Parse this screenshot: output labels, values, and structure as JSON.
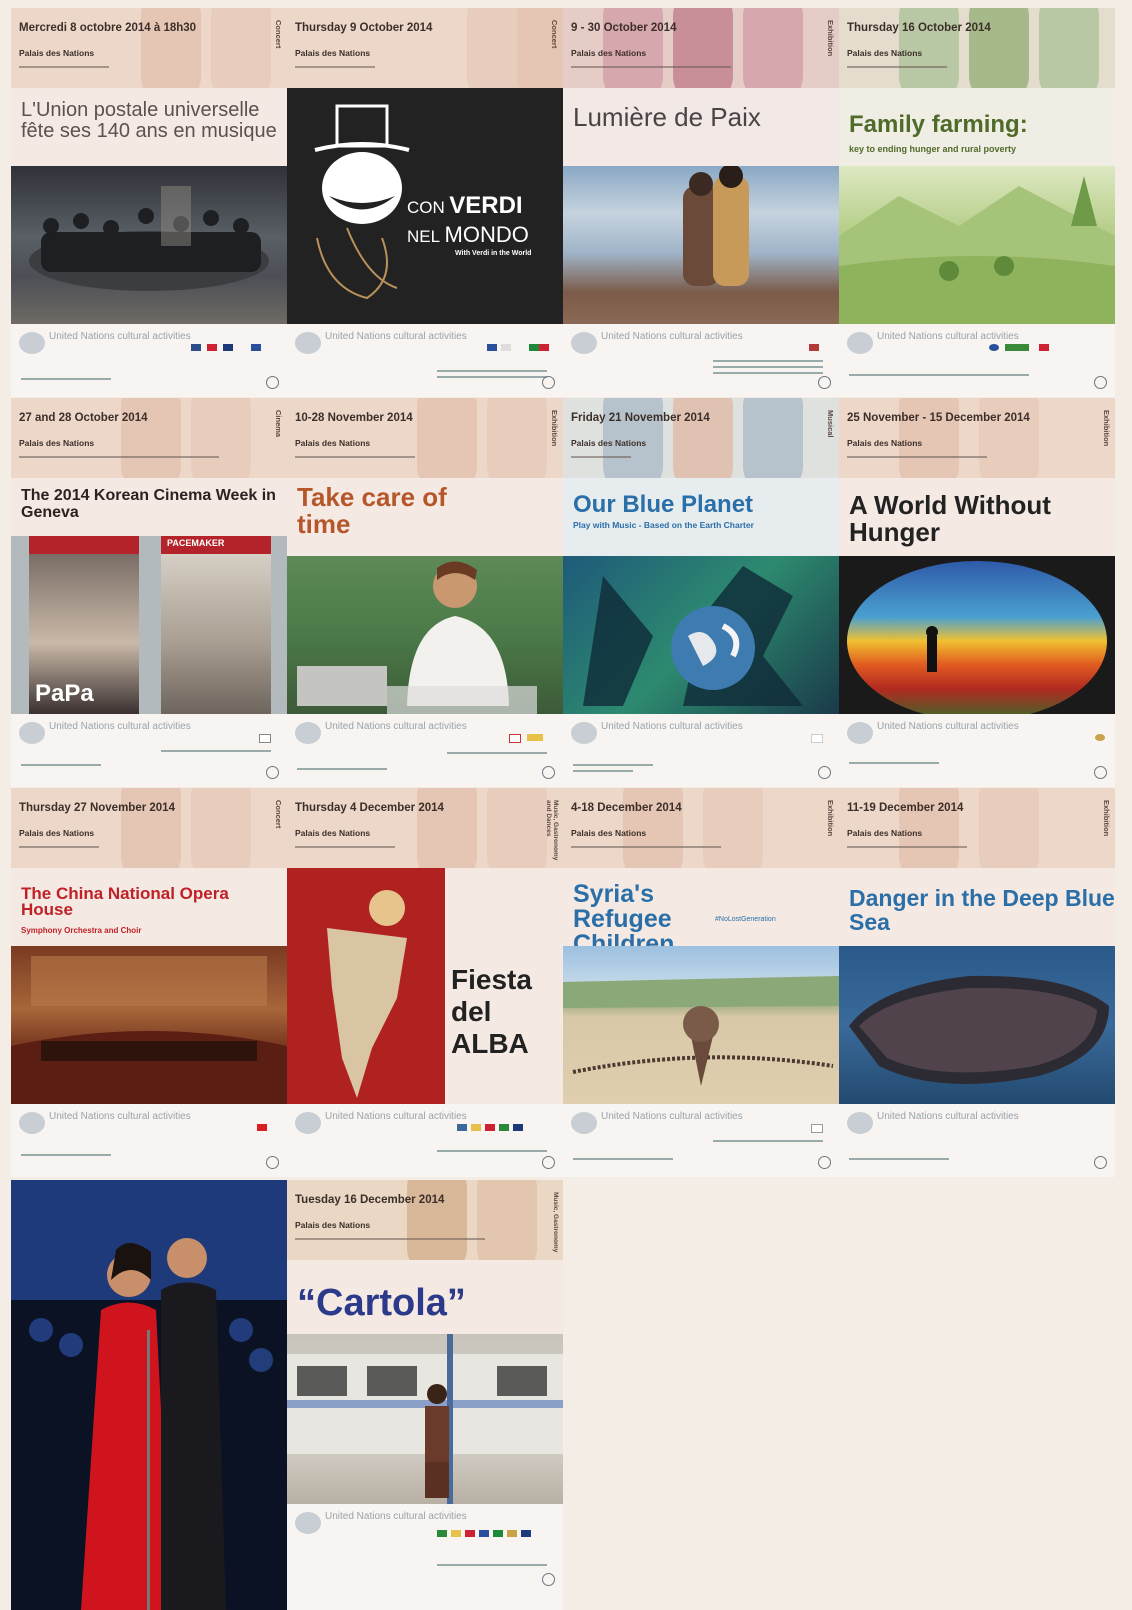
{
  "posters": [
    {
      "date": "Mercredi 8 octobre 2014 à 18h30",
      "venue": "Palais des Nations",
      "category": "Concert",
      "title": "L'Union postale universelle fête ses 140 ans en musique",
      "footer": "United Nations cultural activities"
    },
    {
      "date": "Thursday 9 October 2014",
      "venue": "Palais des Nations",
      "category": "Concert",
      "title_small": "CON",
      "title_big": "VERDI",
      "title_small2": "NEL",
      "title_big2": "MONDO",
      "subtitle": "With Verdi in the World",
      "footer": "United Nations cultural activities"
    },
    {
      "date": "9 - 30 October 2014",
      "venue": "Palais des Nations",
      "category": "Exhibition",
      "title": "Lumière de Paix",
      "footer": "United Nations cultural activities"
    },
    {
      "date": "Thursday 16 October 2014",
      "venue": "Palais des Nations",
      "category": "Exhibition",
      "title": "Family farming:",
      "subtitle": "key to ending hunger and rural poverty",
      "footer": "United Nations cultural activities"
    },
    {
      "date": "27 and 28 October 2014",
      "venue": "Palais des Nations",
      "category": "Cinema",
      "title": "The 2014 Korean Cinema Week in Geneva",
      "film1": "PaPa",
      "film2": "PACEMAKER",
      "footer": "United Nations cultural activities"
    },
    {
      "date": "10-28 November 2014",
      "venue": "Palais des Nations",
      "category": "Exhibition",
      "title": "Take care of time",
      "footer": "United Nations cultural activities"
    },
    {
      "date": "Friday 21 November 2014",
      "venue": "Palais des Nations",
      "category": "Musical",
      "title": "Our Blue Planet",
      "subtitle": "Play with Music - Based on the Earth Charter",
      "footer": "United Nations cultural activities"
    },
    {
      "date": "25 November - 15 December 2014",
      "venue": "Palais des Nations",
      "category": "Exhibition",
      "title": "A World Without Hunger",
      "footer": "United Nations cultural activities"
    },
    {
      "date": "Thursday 27 November 2014",
      "venue": "Palais des Nations",
      "category": "Concert",
      "title": "The China National Opera House",
      "subtitle": "Symphony Orchestra and Choir",
      "footer": "United Nations cultural activities"
    },
    {
      "date": "Thursday 4 December 2014",
      "venue": "Palais des Nations",
      "category": "Music, Gastronomy and Dances",
      "title": "Fiesta del ALBA",
      "footer": "United Nations cultural activities"
    },
    {
      "date": "4-18 December 2014",
      "venue": "Palais des Nations",
      "category": "Exhibition",
      "title": "Syria's Refugee Children",
      "subtitle": "#NoLostGeneration",
      "footer": "United Nations cultural activities"
    },
    {
      "date": "11-19 December 2014",
      "venue": "Palais des Nations",
      "category": "Exhibition",
      "title": "Danger in the Deep Blue Sea",
      "footer": "United Nations cultural activities"
    },
    {
      "kind": "photo"
    },
    {
      "date": "Tuesday 16 December 2014",
      "venue": "Palais des Nations",
      "category": "Music, Gastronomy",
      "title": "“Cartola”",
      "footer": "United Nations cultural activities"
    }
  ],
  "colors": {
    "header_peach": "#ecd7c9",
    "korean_red": "#b4232a",
    "blue_title": "#2a6fa8",
    "orange_title": "#b5572a",
    "china_red": "#c02028",
    "cartola_blue": "#2b3a8a",
    "green_title": "#4f6b2a"
  }
}
